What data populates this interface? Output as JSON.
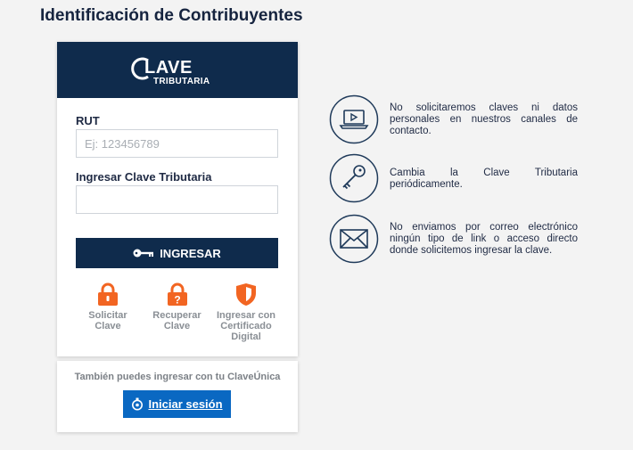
{
  "page": {
    "title": "Identificación de Contribuyentes"
  },
  "logo": {
    "line1": "LAVE",
    "line2": "TRIBUTARIA"
  },
  "form": {
    "rut_label": "RUT",
    "rut_placeholder": "Ej: 123456789",
    "rut_value": "",
    "password_label": "Ingresar Clave Tributaria",
    "password_value": "",
    "submit_label": "INGRESAR"
  },
  "options": [
    {
      "label": "Solicitar Clave",
      "icon": "lock-icon"
    },
    {
      "label": "Recuperar Clave",
      "icon": "lock-question-icon"
    },
    {
      "label": "Ingresar con Certificado Digital",
      "icon": "shield-icon"
    }
  ],
  "claveunica": {
    "text": "También puedes ingresar con tu ClaveÚnica",
    "button_label": "Iniciar sesión"
  },
  "tips": [
    {
      "icon": "laptop-icon",
      "text": "No solicitaremos claves ni datos personales en nuestros canales de contacto."
    },
    {
      "icon": "key-icon",
      "text": "Cambia la Clave Tributaria periódicamente."
    },
    {
      "icon": "envelope-icon",
      "text": "No enviamos por correo electrónico ningún tipo de link o acceso directo donde solicitemos ingresar la clave."
    }
  ],
  "colors": {
    "navy": "#0f2b4c",
    "orange": "#f26522",
    "blue": "#0a68c2",
    "icon_stroke": "#1f3a5a"
  }
}
